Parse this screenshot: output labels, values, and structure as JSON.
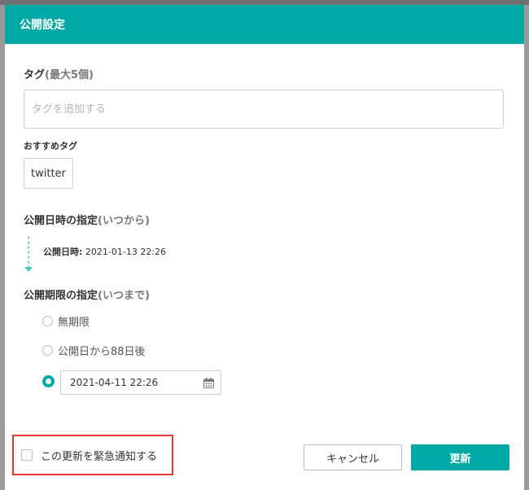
{
  "dialog": {
    "title": "公開設定"
  },
  "tags": {
    "title": "タグ",
    "title_sub": "(最大5個)",
    "input_placeholder": "タグを追加する",
    "input_value": "",
    "recommended_label": "おすすめタグ",
    "recommended": [
      "twitter"
    ]
  },
  "publish_start": {
    "title": "公開日時の指定",
    "title_sub": "(いつから)",
    "date_label": "公開日時:",
    "date_value": "2021-01-13 22:26"
  },
  "publish_end": {
    "title": "公開期限の指定",
    "title_sub": "(いつまで)",
    "options": [
      {
        "label": "無期限",
        "selected": false
      },
      {
        "label": "公開日から88日後",
        "selected": false
      },
      {
        "label": "",
        "selected": true
      }
    ],
    "custom_date": "2021-04-11 22:26",
    "calendar_icon": "calendar-icon"
  },
  "footer": {
    "notify_label": "この更新を緊急通知する",
    "notify_checked": false,
    "cancel_label": "キャンセル",
    "update_label": "更新"
  },
  "colors": {
    "accent": "#00a9a5",
    "highlight_border": "#e53935",
    "dot_line": "#49c6bf"
  }
}
